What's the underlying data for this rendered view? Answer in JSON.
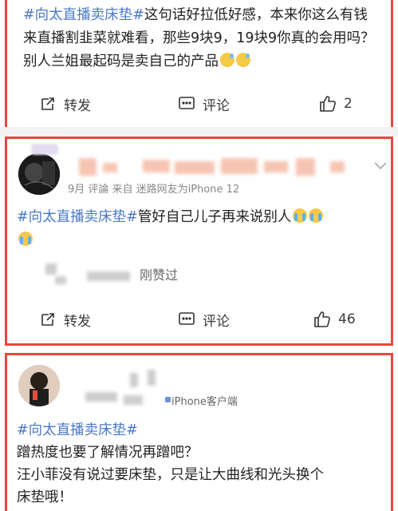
{
  "post1": {
    "topic": "#向太直播卖床垫#",
    "text": "这句话好拉低好感，本来你这么有钱来直播割韭菜就难看，那些9块9，19块9你真的会用吗？别人兰姐最起码是卖自己的产品",
    "emoji": "sweat-smile-emoji",
    "actions": {
      "repost": "转发",
      "comment": "评论",
      "like_count": "2"
    }
  },
  "post2": {
    "meta": "9月 评論  来自 迷路网友为iPhone 12",
    "topic": "#向太直播卖床垫#",
    "text": "管好自己儿子再来说别人",
    "emoji": "crying-emoji",
    "liked_text": "刚赞过",
    "actions": {
      "repost": "转发",
      "comment": "评论",
      "like_count": "46"
    }
  },
  "post3": {
    "meta": "iPhone客户端",
    "topic": "#向太直播卖床垫#",
    "line1": "蹭热度也要了解情况再蹭吧？",
    "line2": "汪小菲没有说过要床垫，只是让大曲线和光头换个",
    "line3": "床垫哦！"
  },
  "colors": {
    "frame": "#e8473d",
    "topic": "#4a78c8",
    "separator": "#f2f2f2"
  }
}
